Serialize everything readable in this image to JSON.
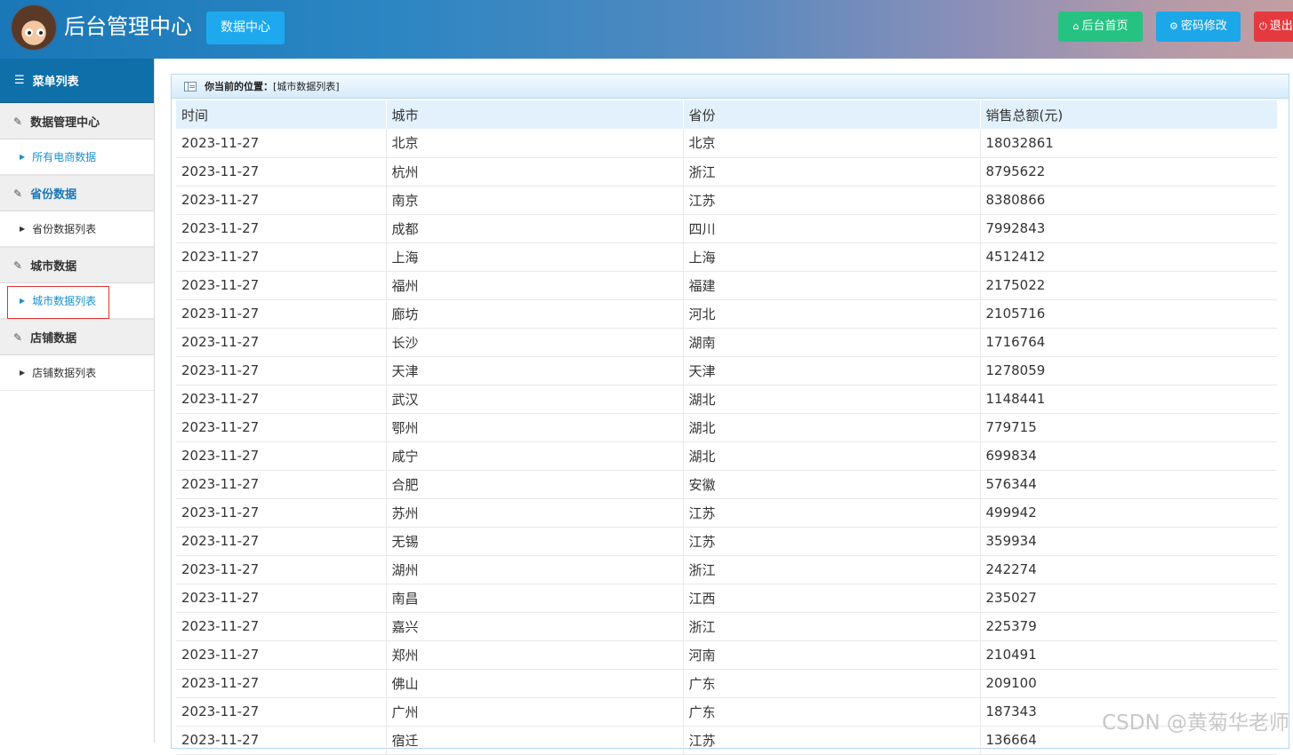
{
  "header": {
    "title": "后台管理中心",
    "data_center_label": "数据中心",
    "home_label": "后台首页",
    "password_label": "密码修改",
    "exit_label": "退出",
    "avatar_icon": "cartoon-avatar-icon"
  },
  "sidebar": {
    "heading": "菜单列表",
    "groups": [
      {
        "label": "数据管理中心",
        "items": [
          {
            "label": "所有电商数据"
          }
        ]
      },
      {
        "label": "省份数据",
        "items": [
          {
            "label": "省份数据列表"
          }
        ]
      },
      {
        "label": "城市数据",
        "items": [
          {
            "label": "城市数据列表"
          }
        ]
      },
      {
        "label": "店铺数据",
        "items": [
          {
            "label": "店铺数据列表"
          }
        ]
      }
    ]
  },
  "breadcrumb": {
    "label": "你当前的位置：",
    "value": "[城市数据列表]"
  },
  "table": {
    "headers": [
      "时间",
      "城市",
      "省份",
      "销售总额(元)"
    ],
    "rows": [
      [
        "2023-11-27",
        "北京",
        "北京",
        "18032861"
      ],
      [
        "2023-11-27",
        "杭州",
        "浙江",
        "8795622"
      ],
      [
        "2023-11-27",
        "南京",
        "江苏",
        "8380866"
      ],
      [
        "2023-11-27",
        "成都",
        "四川",
        "7992843"
      ],
      [
        "2023-11-27",
        "上海",
        "上海",
        "4512412"
      ],
      [
        "2023-11-27",
        "福州",
        "福建",
        "2175022"
      ],
      [
        "2023-11-27",
        "廊坊",
        "河北",
        "2105716"
      ],
      [
        "2023-11-27",
        "长沙",
        "湖南",
        "1716764"
      ],
      [
        "2023-11-27",
        "天津",
        "天津",
        "1278059"
      ],
      [
        "2023-11-27",
        "武汉",
        "湖北",
        "1148441"
      ],
      [
        "2023-11-27",
        "鄂州",
        "湖北",
        "779715"
      ],
      [
        "2023-11-27",
        "咸宁",
        "湖北",
        "699834"
      ],
      [
        "2023-11-27",
        "合肥",
        "安徽",
        "576344"
      ],
      [
        "2023-11-27",
        "苏州",
        "江苏",
        "499942"
      ],
      [
        "2023-11-27",
        "无锡",
        "江苏",
        "359934"
      ],
      [
        "2023-11-27",
        "湖州",
        "浙江",
        "242274"
      ],
      [
        "2023-11-27",
        "南昌",
        "江西",
        "235027"
      ],
      [
        "2023-11-27",
        "嘉兴",
        "浙江",
        "225379"
      ],
      [
        "2023-11-27",
        "郑州",
        "河南",
        "210491"
      ],
      [
        "2023-11-27",
        "佛山",
        "广东",
        "209100"
      ],
      [
        "2023-11-27",
        "广州",
        "广东",
        "187343"
      ],
      [
        "2023-11-27",
        "宿迁",
        "江苏",
        "136664"
      ]
    ]
  },
  "watermark": "CSDN @黄菊华老师"
}
